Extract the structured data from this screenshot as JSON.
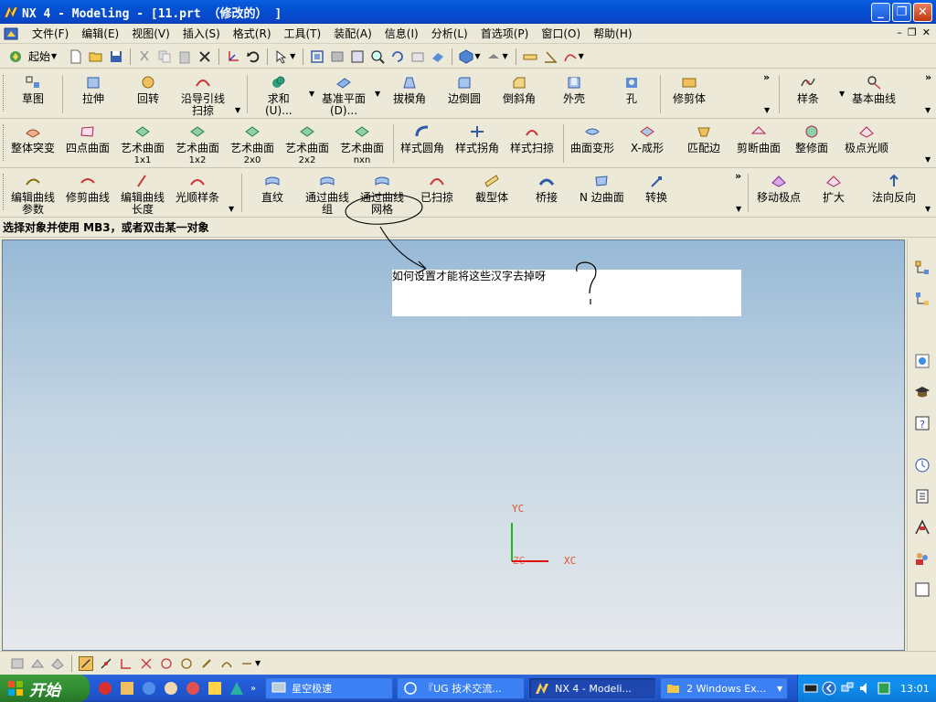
{
  "window": {
    "title": "NX 4 - Modeling - [11.prt  （修改的） ]",
    "buttons": [
      "_",
      "❐",
      "✕"
    ]
  },
  "menubar": {
    "items": [
      "文件(F)",
      "编辑(E)",
      "视图(V)",
      "插入(S)",
      "格式(R)",
      "工具(T)",
      "装配(A)",
      "信息(I)",
      "分析(L)",
      "首选项(P)",
      "窗口(O)",
      "帮助(H)"
    ],
    "right_controls": [
      "–",
      "❐",
      "✕"
    ]
  },
  "standard_toolbar": {
    "start_label": "起始"
  },
  "toolbar_features": {
    "sketch": "草图",
    "extrude": "拉伸",
    "revolve": "回转",
    "sweep_line1": "沿导引线",
    "sweep_line2": "扫掠",
    "boolean_line1": "求和",
    "boolean_line2": "(U)...",
    "datum_line1": "基准平面",
    "datum_line2": "(D)...",
    "draft": "拔模角",
    "edge_blend": "边倒圆",
    "chamfer": "倒斜角",
    "shell": "外壳",
    "hole": "孔",
    "trim_body": "修剪体",
    "spline": "样条",
    "basic_curves": "基本曲线"
  },
  "toolbar_surfaces": {
    "through_sweep": "整体突变",
    "four_point": "四点曲面",
    "studio1_line1": "艺术曲面",
    "studio1_line2": "1x1",
    "studio2_line1": "艺术曲面",
    "studio2_line2": "1x2",
    "studio3_line1": "艺术曲面",
    "studio3_line2": "2x0",
    "studio4_line1": "艺术曲面",
    "studio4_line2": "2x2",
    "studio5_line1": "艺术曲面",
    "studio5_line2": "nxn",
    "styled_blend": "样式圆角",
    "styled_corner": "样式拐角",
    "styled_sweep": "样式扫掠",
    "global_shaping": "曲面变形",
    "x_form": "X-成形",
    "match_edge": "匹配边",
    "section_surface": "剪断曲面",
    "trim_surface": "整修面",
    "smooth_poles": "极点光顺"
  },
  "toolbar_freeform": {
    "edit_curve_param_line1": "编辑曲线",
    "edit_curve_param_line2": "参数",
    "trim_curve": "修剪曲线",
    "edit_curve_len_line1": "编辑曲线",
    "edit_curve_len_line2": "长度",
    "smooth_spline": "光顺样条",
    "ruled": "直纹",
    "through_curves_line1": "通过曲线",
    "through_curves_line2": "组",
    "through_mesh_line1": "通过曲线",
    "through_mesh_line2": "网格",
    "swept": "已扫掠",
    "section": "截型体",
    "bridge": "桥接",
    "n_sided": "N 边曲面",
    "transform": "转换",
    "move_pole": "移动极点",
    "enlarge": "扩大",
    "normal_reverse": "法向反向"
  },
  "status": {
    "prompt": "选择对象并使用 MB3，或者双击某一对象"
  },
  "viewport": {
    "annotation": "如何设置才能将这些汉字去掉呀",
    "axis_y": "YC",
    "axis_x": "XC",
    "axis_z": "ZC"
  },
  "taskbar": {
    "start": "开始",
    "tasks": [
      "星空极速",
      "『UG 技术交流...",
      "NX 4 - Modeli...",
      "2 Windows Ex..."
    ],
    "clock": "13:01"
  },
  "colors": {
    "titlebar": "#0a5ee0",
    "axis": "#e0502a",
    "start_button": "#3c9c3c"
  }
}
